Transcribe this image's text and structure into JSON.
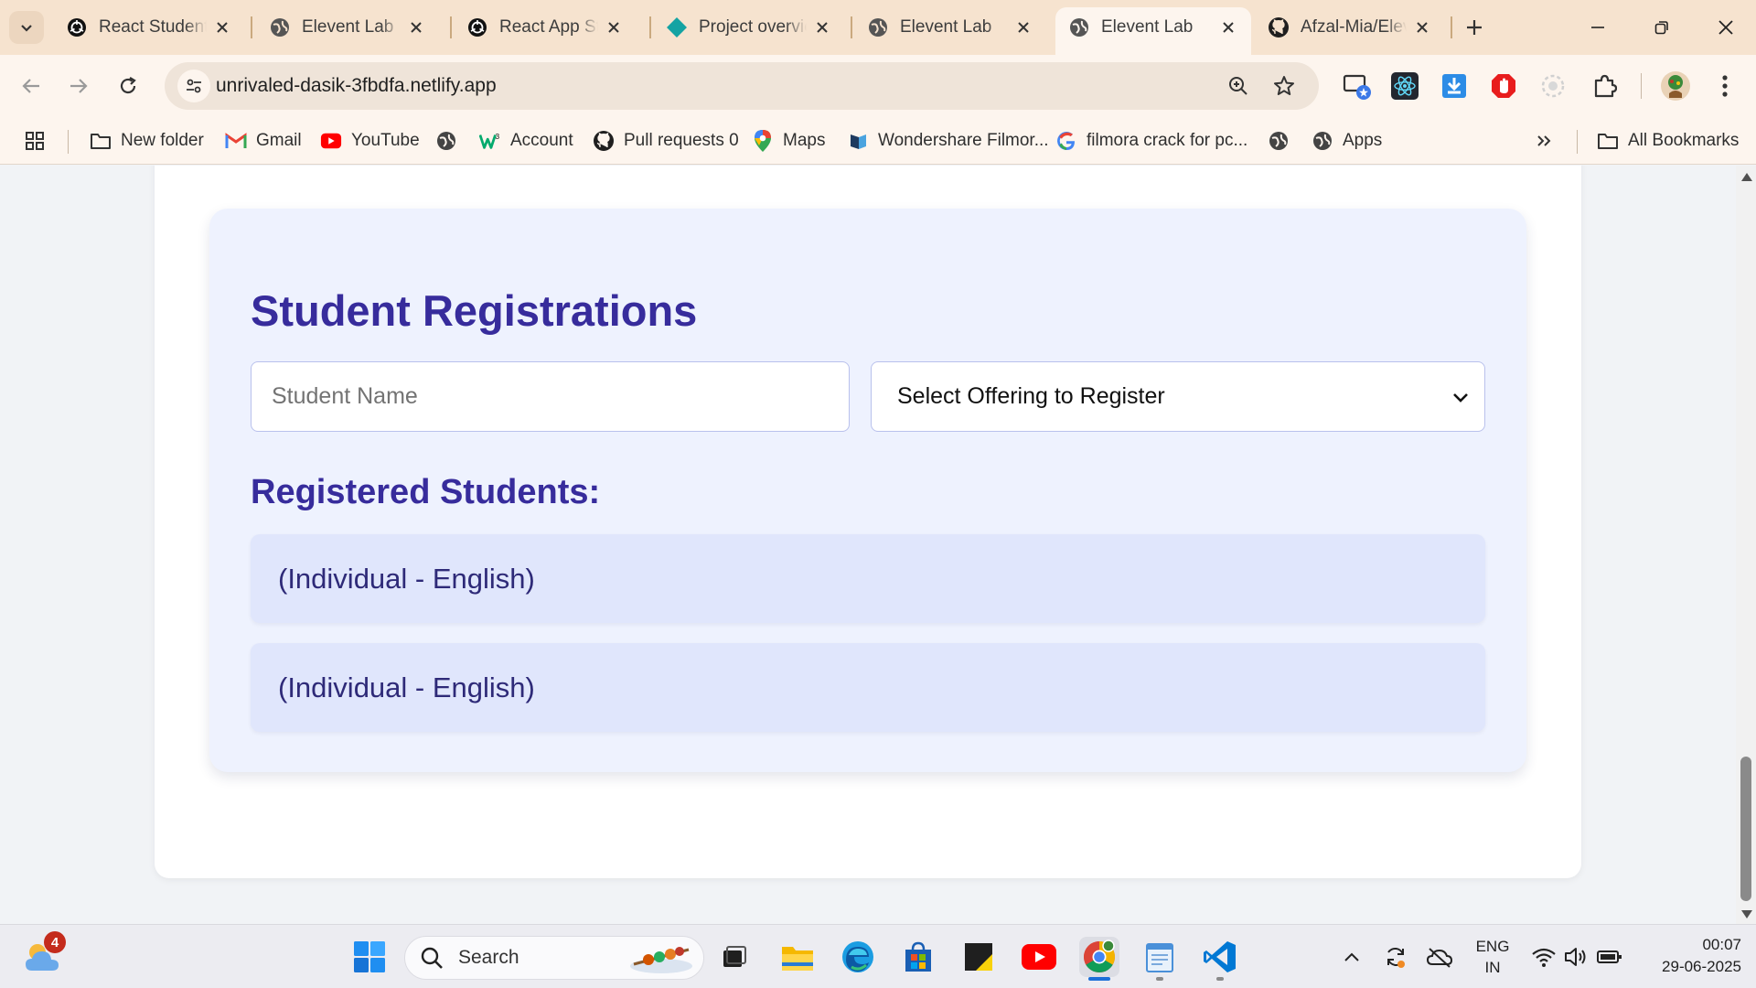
{
  "browser": {
    "tabs": [
      {
        "title": "React Student",
        "icon": "chatgpt-icon",
        "active": false
      },
      {
        "title": "Elevent Lab",
        "icon": "globe-icon",
        "active": false
      },
      {
        "title": "React App Styl",
        "icon": "chatgpt-icon",
        "active": false
      },
      {
        "title": "Project overvie",
        "icon": "diamond-icon",
        "active": false
      },
      {
        "title": "Elevent Lab",
        "icon": "globe-icon",
        "active": false
      },
      {
        "title": "Elevent Lab",
        "icon": "globe-icon",
        "active": true
      },
      {
        "title": "Afzal-Mia/Elev",
        "icon": "github-icon",
        "active": false
      }
    ],
    "url": "unrivaled-dasik-3fbdfa.netlify.app",
    "bookmarks": [
      {
        "label": "New folder",
        "icon": "folder-icon"
      },
      {
        "label": "Gmail",
        "icon": "gmail-icon"
      },
      {
        "label": "YouTube",
        "icon": "youtube-icon"
      },
      {
        "label": "",
        "icon": "globe-icon"
      },
      {
        "label": "Account",
        "icon": "w3-icon"
      },
      {
        "label": "Pull requests 0",
        "icon": "github-icon"
      },
      {
        "label": "Maps",
        "icon": "maps-icon"
      },
      {
        "label": "Wondershare Filmor...",
        "icon": "filmora-icon"
      },
      {
        "label": "filmora crack for pc...",
        "icon": "google-icon"
      },
      {
        "label": "",
        "icon": "globe-icon"
      },
      {
        "label": "Apps",
        "icon": "globe-icon"
      }
    ],
    "all_bookmarks": "All Bookmarks"
  },
  "page": {
    "title": "Student Registrations",
    "student_name_placeholder": "Student Name",
    "offering_select": "Select Offering to Register",
    "registered_heading": "Registered Students:",
    "registered": [
      "(Individual - English)",
      "(Individual - English)"
    ]
  },
  "taskbar": {
    "search_placeholder": "Search",
    "weather_badge": "4",
    "language": "ENG",
    "region": "IN",
    "time": "00:07",
    "date": "29-06-2025"
  }
}
